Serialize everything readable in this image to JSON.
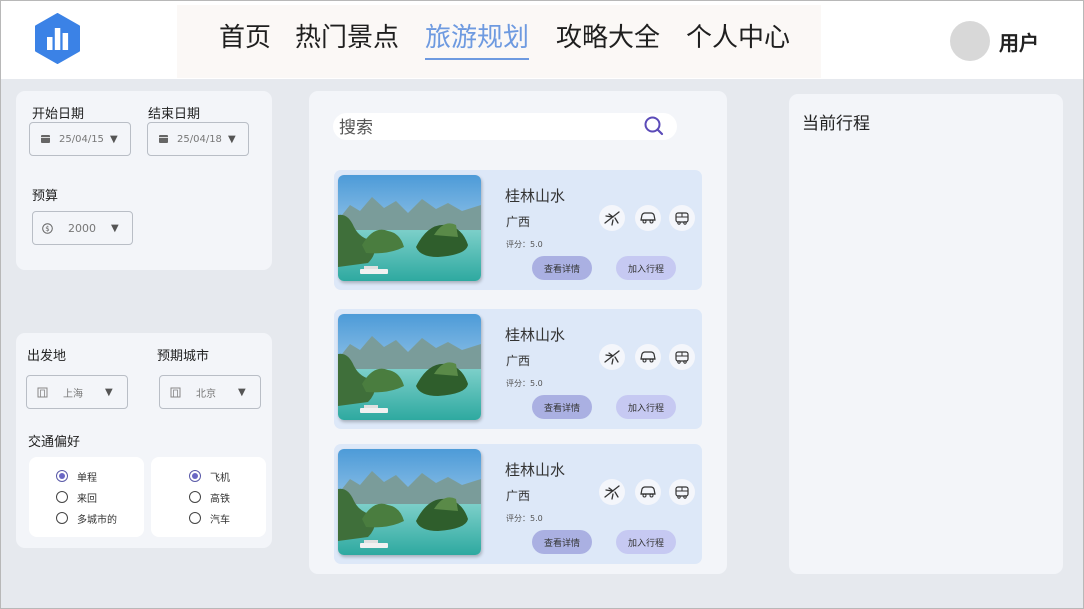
{
  "header": {
    "nav": [
      "首页",
      "热门景点",
      "旅游规划",
      "攻略大全",
      "个人中心"
    ],
    "active_nav": "旅游规划",
    "user_label": "用户"
  },
  "dates": {
    "start_label": "开始日期",
    "start_value": "25/04/15",
    "end_label": "结束日期",
    "end_value": "25/04/18"
  },
  "budget": {
    "label": "预算",
    "value": "2000"
  },
  "route": {
    "origin_label": "出发地",
    "origin_value": "上海",
    "dest_label": "预期城市",
    "dest_value": "北京",
    "transport_label": "交通偏好",
    "trip_types": [
      {
        "label": "单程",
        "selected": true
      },
      {
        "label": "来回",
        "selected": false
      },
      {
        "label": "多城市的",
        "selected": false
      }
    ],
    "modes": [
      {
        "label": "飞机",
        "selected": true
      },
      {
        "label": "高铁",
        "selected": false
      },
      {
        "label": "汽车",
        "selected": false
      }
    ]
  },
  "search": {
    "placeholder": "搜索"
  },
  "results": [
    {
      "title": "桂林山水",
      "region": "广西",
      "score": "评分：5.0",
      "detail_label": "查看详情",
      "add_label": "加入行程"
    },
    {
      "title": "桂林山水",
      "region": "广西",
      "score": "评分：5.0",
      "detail_label": "查看详情",
      "add_label": "加入行程"
    },
    {
      "title": "桂林山水",
      "region": "广西",
      "score": "评分：5.0",
      "detail_label": "查看详情",
      "add_label": "加入行程"
    }
  ],
  "itinerary": {
    "title": "当前行程"
  },
  "colors": {
    "accent": "#6e9ae0",
    "logo": "#3b82e6",
    "search_icon": "#5b4bb8",
    "result_card": "#dde8f8",
    "detail_button": "#aab0e2",
    "add_button": "#c6c9f2"
  },
  "icons": {
    "logo": "bar-chart-hexagon-icon",
    "calendar": "calendar-icon",
    "budget": "currency-icon",
    "building": "building-icon",
    "search": "search-icon",
    "plane": "plane-icon",
    "car": "car-icon",
    "bus": "bus-icon",
    "caret": "caret-down-icon"
  }
}
